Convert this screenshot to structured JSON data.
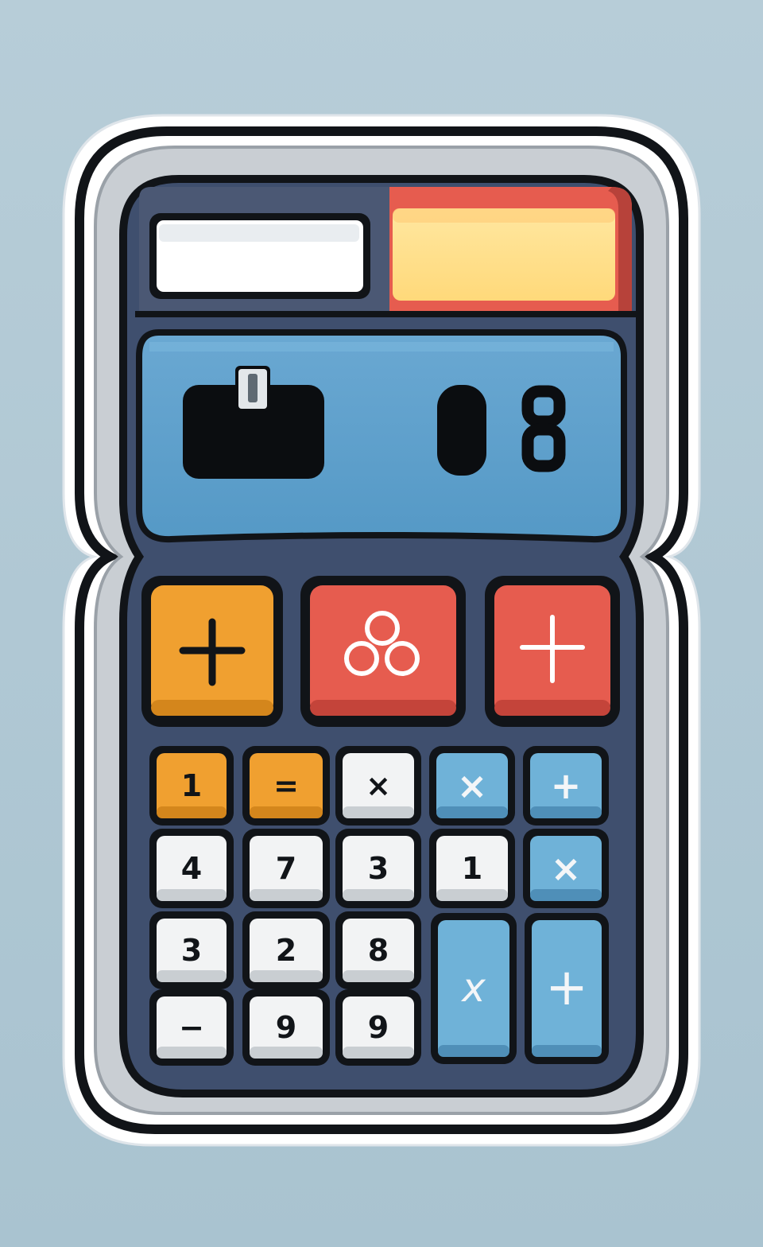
{
  "display": {
    "small_indicator": "0",
    "main_digit": "8"
  },
  "big_keys": [
    {
      "name": "orange-plus-key",
      "symbol": "plus",
      "color": "#f0a030"
    },
    {
      "name": "red-circles-key",
      "symbol": "three-circles",
      "color": "#e65c4f"
    },
    {
      "name": "red-plus-key",
      "symbol": "plus",
      "color": "#e65c4f"
    }
  ],
  "keypad": {
    "row1": [
      "1",
      "=",
      "×",
      "×",
      "+"
    ],
    "row2": [
      "4",
      "7",
      "3",
      "1",
      "×"
    ],
    "row3": [
      "3",
      "2",
      "8"
    ],
    "row4": [
      "−",
      "9",
      "9"
    ],
    "tall_keys": [
      "x",
      "+"
    ]
  },
  "colors": {
    "body": "#3f4f6e",
    "screen": "#5ea0cc",
    "orange": "#f0a030",
    "red": "#e65c4f",
    "blue_key": "#6fb2d8",
    "white_key": "#f2f3f4",
    "solar_panel_yellow": "#ffe38a"
  }
}
